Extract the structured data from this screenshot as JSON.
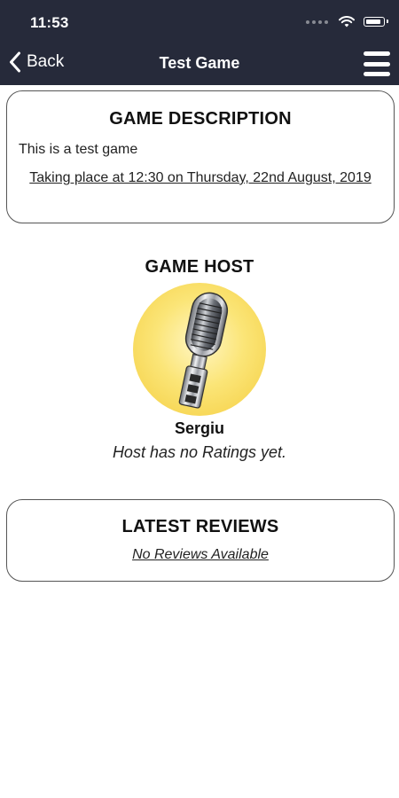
{
  "status_bar": {
    "time": "11:53",
    "icons": [
      "signal-icon",
      "wifi-icon",
      "battery-icon"
    ]
  },
  "nav": {
    "back_label": "Back",
    "title": "Test Game",
    "menu_icon": "hamburger-menu-icon"
  },
  "description_card": {
    "title": "GAME DESCRIPTION",
    "text": "This is a test game",
    "when": "Taking place at 12:30 on Thursday, 22nd August, 2019"
  },
  "host": {
    "heading": "GAME HOST",
    "avatar_icon": "microphone-icon",
    "name": "Sergiu",
    "rating_text": "Host has no Ratings yet."
  },
  "reviews_card": {
    "title": "LATEST REVIEWS",
    "empty_text": "No Reviews Available"
  },
  "colors": {
    "nav_background": "#262a3a",
    "avatar_gradient": "#fbe577"
  }
}
